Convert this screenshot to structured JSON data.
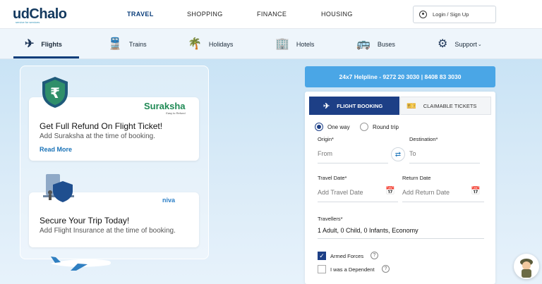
{
  "brand": {
    "name": "udChalo",
    "tagline": "service for services"
  },
  "topnav": [
    {
      "label": "TRAVEL",
      "active": true
    },
    {
      "label": "SHOPPING",
      "active": false
    },
    {
      "label": "FINANCE",
      "active": false
    },
    {
      "label": "HOUSING",
      "active": false
    }
  ],
  "login_label": "Login / Sign Up",
  "subnav": [
    {
      "label": "Flights",
      "icon": "plane-icon"
    },
    {
      "label": "Trains",
      "icon": "train-icon"
    },
    {
      "label": "Holidays",
      "icon": "palm-tree-icon"
    },
    {
      "label": "Hotels",
      "icon": "hotel-icon"
    },
    {
      "label": "Buses",
      "icon": "bus-icon"
    },
    {
      "label": "Support",
      "icon": "support-gear-icon"
    }
  ],
  "promo": {
    "card1": {
      "title": "Get Full Refund On Flight Ticket!",
      "text": "Add Suraksha at the time of booking.",
      "link": "Read More",
      "partner": "Suraksha",
      "partner_tag": "Easy to Refund"
    },
    "card2": {
      "title": "Secure Your Trip Today!",
      "text": "Add Flight Insurance at the time of booking.",
      "partner": "niva"
    }
  },
  "helpline": "24x7 Helpline - 9272 20 3030 | 8408 83 3030",
  "booking": {
    "tab_flight": "FLIGHT BOOKING",
    "tab_claim": "CLAIMABLE TICKETS",
    "trip_oneway": "One way",
    "trip_round": "Round trip",
    "origin_label": "Origin*",
    "origin_placeholder": "From",
    "dest_label": "Destination*",
    "dest_placeholder": "To",
    "travel_date_label": "Travel Date*",
    "travel_date_placeholder": "Add Travel Date",
    "return_date_label": "Return Date",
    "return_date_placeholder": "Add Return Date",
    "travellers_label": "Travellers*",
    "travellers_value": "1 Adult, 0 Child, 0 Infants, Economy",
    "armed_forces": "Armed Forces",
    "dependent": "I was a Dependent",
    "armed_forces_checked": true,
    "dependent_checked": false
  },
  "colors": {
    "primary": "#1d3f86",
    "accent": "#4aa6e6",
    "link": "#1a73b8"
  }
}
